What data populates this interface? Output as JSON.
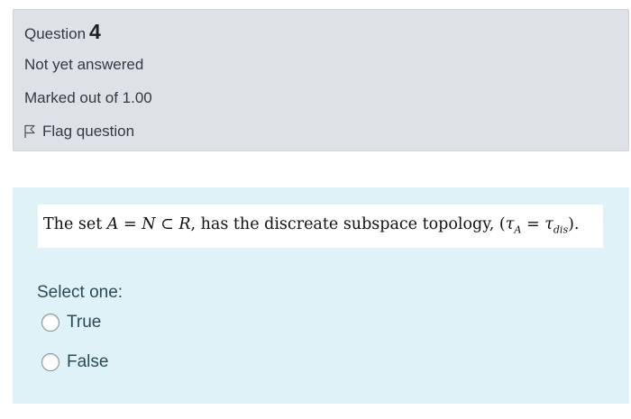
{
  "info": {
    "question_label": "Question",
    "question_number": "4",
    "state": "Not yet answered",
    "grade": "Marked out of 1.00",
    "flag_label": "Flag question"
  },
  "question": {
    "text": "The set A = N ⊂ R, has the discreate subspace topology, (τA = τdis).",
    "prompt": "Select one:",
    "options": [
      {
        "label": "True",
        "checked": false
      },
      {
        "label": "False",
        "checked": false
      }
    ]
  },
  "colors": {
    "info_background": "#dee2e6",
    "formulation_background": "#def2f8"
  }
}
